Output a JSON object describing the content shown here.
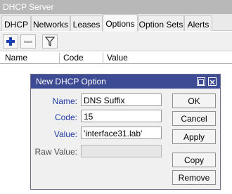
{
  "app": {
    "title": "DHCP Server"
  },
  "tabs": [
    {
      "label": "DHCP"
    },
    {
      "label": "Networks"
    },
    {
      "label": "Leases"
    },
    {
      "label": "Options"
    },
    {
      "label": "Option Sets"
    },
    {
      "label": "Alerts"
    }
  ],
  "active_tab": "Options",
  "toolbar": {
    "icons": [
      "add-icon",
      "remove-icon",
      "filter-icon"
    ]
  },
  "table": {
    "columns": [
      "Name",
      "Code",
      "Value"
    ]
  },
  "dialog": {
    "title": "New DHCP Option",
    "fields": {
      "name_label": "Name:",
      "name_value": "DNS Suffix",
      "code_label": "Code:",
      "code_value": "15",
      "value_label": "Value:",
      "value_value": "'interface31.lab'",
      "raw_label": "Raw Value:",
      "raw_value": ""
    },
    "buttons": {
      "ok": "OK",
      "cancel": "Cancel",
      "apply": "Apply",
      "copy": "Copy",
      "remove": "Remove"
    }
  },
  "colors": {
    "dialog_title_bg": "#3c4b93",
    "label_blue": "#1f3aa5",
    "add_icon": "#1740b0"
  }
}
